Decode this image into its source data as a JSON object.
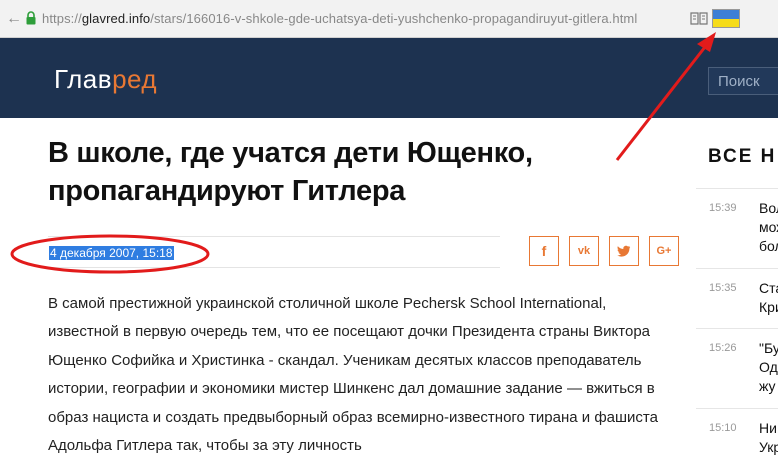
{
  "browser": {
    "url_host": "glavred.info",
    "url_prefix": "https://",
    "url_path": "/stars/166016-v-shkole-gde-uchatsya-deti-yushchenko-propagandiruyut-gitlera.html"
  },
  "site": {
    "logo_main": "Глав",
    "logo_accent": "ред",
    "search_placeholder": "Поиск",
    "colors": {
      "header_bg": "#1d3250",
      "accent": "#e87834"
    }
  },
  "article": {
    "title": "В школе, где учатся дети Ющенко, пропагандируют Гитлера",
    "date": "4 декабря 2007, 15:18",
    "share": {
      "facebook": "f",
      "vk": "vk",
      "twitter": "tw",
      "googleplus": "G+"
    },
    "body": "В самой престижной украинской столичной школе Pechersk School International, известной в первую очередь тем, что ее посещают дочки Президента страны Виктора Ющенко Софийка и Христинка - скандал. Ученикам десятых классов преподаватель истории, географии и экономики мистер Шинкенс дал домашние задание — вжиться в образ нациста и создать предвыборный образ всемирно-известного тирана и фашиста Адольфа Гитлера так, чтобы за эту личность"
  },
  "sidebar": {
    "title": "ВСЕ Н",
    "items": [
      {
        "time": "15:39",
        "line1": "Вол",
        "line2": "мож",
        "line3": "бол"
      },
      {
        "time": "15:35",
        "line1": "Ста",
        "line2": "Кри",
        "line3": ""
      },
      {
        "time": "15:26",
        "line1": "\"Бу",
        "line2": "Од",
        "line3": "жу"
      },
      {
        "time": "15:10",
        "line1": "Ни",
        "line2": "Укр",
        "line3": ""
      }
    ]
  },
  "annotation": {
    "color": "#e21b1b"
  }
}
